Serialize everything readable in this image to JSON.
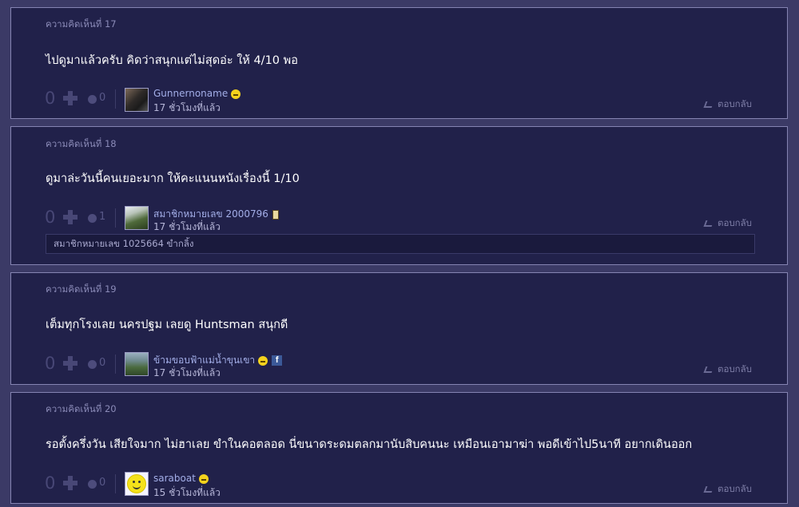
{
  "comments": [
    {
      "number": "ความคิดเห็นที่ 17",
      "text": "ไปดูมาแล้วครับ คิดว่าสนุกแต่ไม่สุดอ่ะ  ให้ 4/10 พอ",
      "votes": "0",
      "emotions": "0",
      "username": "Gunnernoname",
      "time": "17 ชั่วโมงที่แล้ว",
      "reply": "ตอบกลับ"
    },
    {
      "number": "ความคิดเห็นที่ 18",
      "text": "ดูมาล่ะวันนี้คนเยอะมาก ให้คะแนนหนังเรื่องนี้ 1/10",
      "votes": "0",
      "emotions": "1",
      "username": "สมาชิกหมายเลข 2000796",
      "time": "17 ชั่วโมงที่แล้ว",
      "reply": "ตอบกลับ",
      "subreply": "สมาชิกหมายเลข 1025664 ขำกลิ้ง"
    },
    {
      "number": "ความคิดเห็นที่ 19",
      "text": "เต็มทุกโรงเลย นครปฐม เลยดู Huntsman สนุกดี",
      "votes": "0",
      "emotions": "0",
      "username": "ข้ามขอบฟ้าแม่น้ำขุนเขา",
      "time": "17 ชั่วโมงที่แล้ว",
      "reply": "ตอบกลับ"
    },
    {
      "number": "ความคิดเห็นที่ 20",
      "text": "รอตั้งครึ่งวัน เสียใจมาก ไม่ฮาเลย ขำในคอตลอด นี่ขนาดระดมตลกมานับสิบคนนะ เหมือนเอามาฆ่า พอดีเข้าไป5นาที อยากเดินออก",
      "votes": "0",
      "emotions": "0",
      "username": "saraboat",
      "time": "15 ชั่วโมงที่แล้ว",
      "reply": "ตอบกลับ"
    }
  ],
  "icons": {
    "plus": "plus-icon",
    "emotion": "emotion-icon",
    "reply": "reply-icon",
    "badge_smile": "smiley-badge-icon",
    "badge_phone": "mobile-badge-icon",
    "badge_facebook": "facebook-badge-icon",
    "facebook_letter": "f"
  },
  "colors": {
    "page_bg": "#3b3a66",
    "card_bg": "#21214a",
    "card_border": "#8584b2",
    "username": "#a3aee8"
  }
}
